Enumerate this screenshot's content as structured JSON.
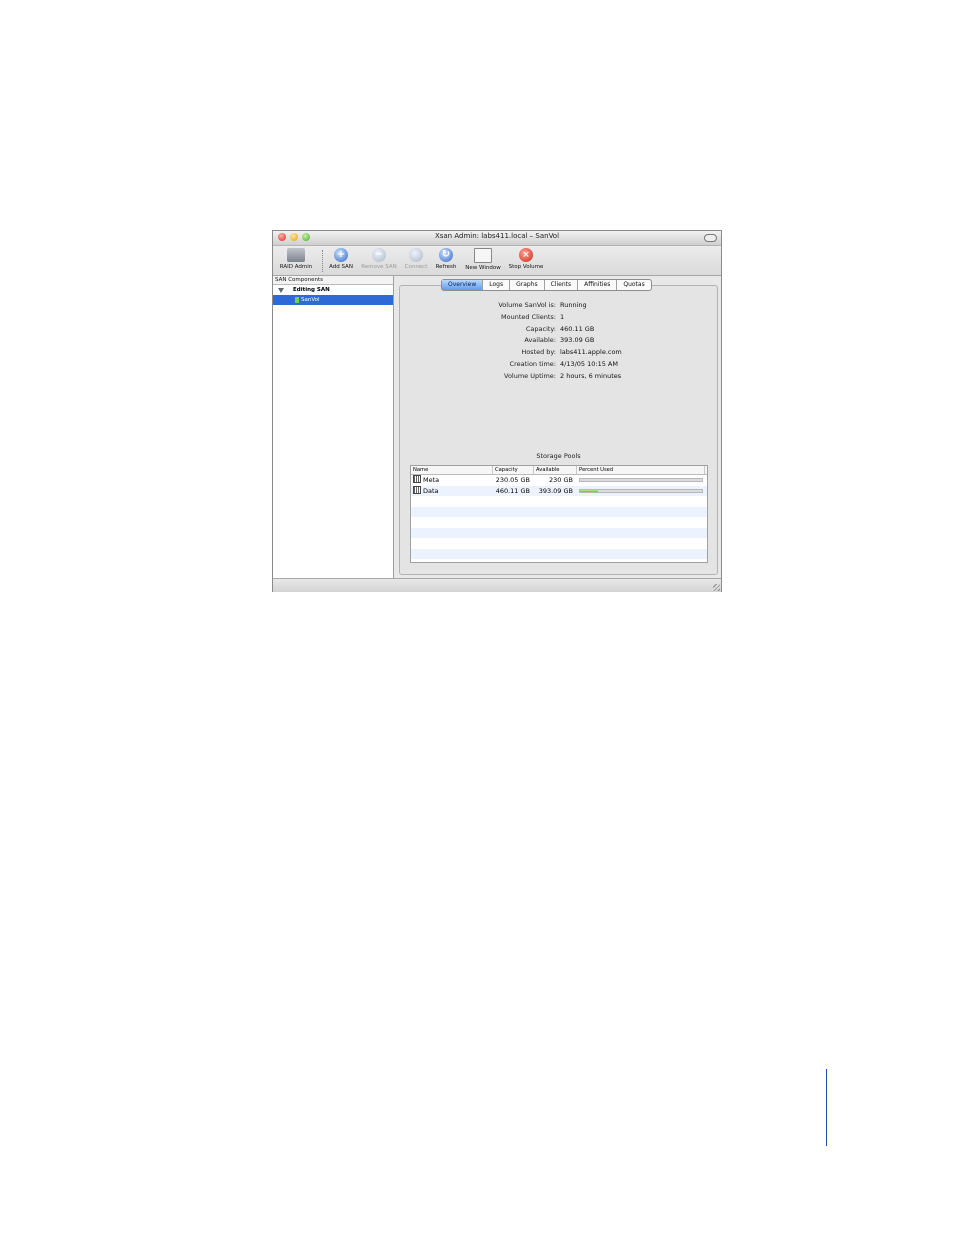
{
  "window": {
    "title": "Xsan Admin: labs411.local – SanVol"
  },
  "toolbar": {
    "raid_admin": "RAID Admin",
    "add_san": "Add SAN",
    "remove_san": "Remove SAN",
    "connect": "Connect",
    "refresh": "Refresh",
    "new_window": "New Window",
    "stop_volume": "Stop Volume"
  },
  "sidebar": {
    "header": "SAN Components",
    "group": "Editing SAN",
    "selected_item": "SanVol"
  },
  "tabs": [
    "Overview",
    "Logs",
    "Graphs",
    "Clients",
    "Affinities",
    "Quotas"
  ],
  "active_tab": "Overview",
  "overview": {
    "rows": [
      {
        "label": "Volume SanVol is:",
        "value": "Running"
      },
      {
        "label": "Mounted Clients:",
        "value": "1"
      },
      {
        "label": "Capacity:",
        "value": "460.11 GB"
      },
      {
        "label": "Available:",
        "value": "393.09 GB"
      },
      {
        "label": "Hosted by:",
        "value": "labs411.apple.com"
      },
      {
        "label": "Creation time:",
        "value": "4/13/05 10:15 AM"
      },
      {
        "label": "Volume Uptime:",
        "value": "2 hours, 6 minutes"
      }
    ]
  },
  "storage_pools": {
    "title": "Storage Pools",
    "columns": [
      "Name",
      "Capacity",
      "Available",
      "Percent Used"
    ],
    "rows": [
      {
        "name": "Meta",
        "capacity": "230.05 GB",
        "available": "230 GB",
        "percent_used": 0.0
      },
      {
        "name": "Data",
        "capacity": "460.11 GB",
        "available": "393.09 GB",
        "percent_used": 14.6
      }
    ]
  },
  "colors": {
    "selection": "#2e6ad6",
    "progress_fill": "#58c22c",
    "active_tab": "#5f9cf0",
    "stop_icon": "#d0281a"
  },
  "icons": [
    "raid-admin-icon",
    "add-san-icon",
    "remove-san-icon",
    "connect-icon",
    "refresh-icon",
    "new-window-icon",
    "stop-volume-icon",
    "disclosure-triangle-icon",
    "volume-icon",
    "storage-pool-icon"
  ]
}
